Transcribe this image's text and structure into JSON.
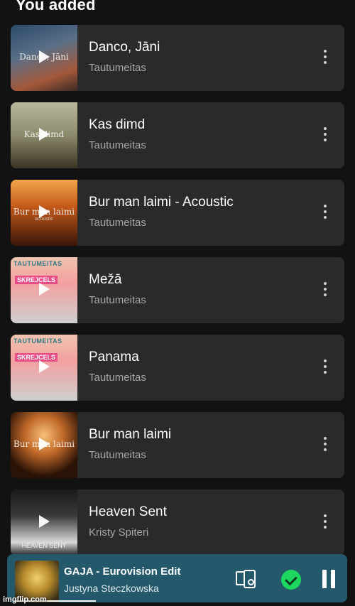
{
  "section": {
    "title": "You added"
  },
  "tracks": [
    {
      "title": "Danco, Jāni",
      "artist": "Tautumeitas",
      "art_caption": "Danco, Jāni",
      "art_sub": ""
    },
    {
      "title": "Kas dimd",
      "artist": "Tautumeitas",
      "art_caption": "Kas dimd",
      "art_sub": ""
    },
    {
      "title": "Bur man laimi - Acoustic",
      "artist": "Tautumeitas",
      "art_caption": "Bur man laimi",
      "art_sub": "acoustic"
    },
    {
      "title": "Mežā",
      "artist": "Tautumeitas",
      "art_band": "TAUTUMEITAS",
      "art_tag": "SKREJCELS"
    },
    {
      "title": "Panama",
      "artist": "Tautumeitas",
      "art_band": "TAUTUMEITAS",
      "art_tag": "SKREJCELS"
    },
    {
      "title": "Bur man laimi",
      "artist": "Tautumeitas",
      "art_caption": "Bur man laimi",
      "art_sub": ""
    },
    {
      "title": "Heaven Sent",
      "artist": "Kristy Spiteri",
      "art_caption": "HEAVEN SENT",
      "art_sub": ""
    }
  ],
  "now_playing": {
    "title": "GAJA - Eurovision Edit",
    "artist": "Justyna Steczkowska",
    "progress": 0.25,
    "saved": true,
    "state": "playing"
  },
  "icons": {
    "track_action": "play-icon",
    "track_menu": "more-vertical-icon",
    "device": "connect-device-icon",
    "saved": "check-circle-icon",
    "pause": "pause-icon"
  },
  "colors": {
    "background": "#121212",
    "card": "#2a2a2a",
    "now_playing_bar": "#23596a",
    "saved_green": "#1ed760",
    "secondary_text": "#a7a7a7"
  },
  "watermark": "imgflip.com"
}
